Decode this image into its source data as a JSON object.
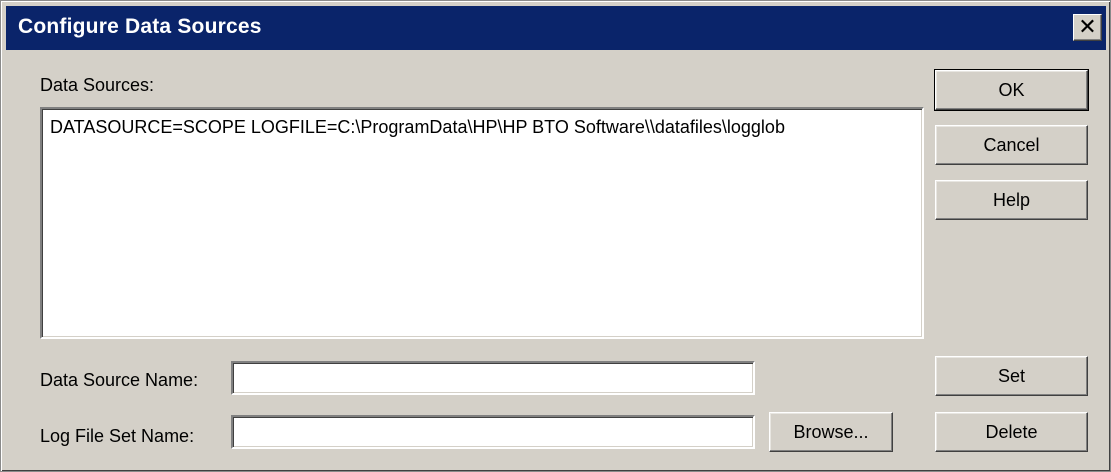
{
  "window": {
    "title": "Configure Data Sources",
    "close_glyph": "✕"
  },
  "data_sources": {
    "label": "Data Sources:",
    "items": [
      "DATASOURCE=SCOPE  LOGFILE=C:\\ProgramData\\HP\\HP BTO Software\\\\datafiles\\logglob"
    ]
  },
  "fields": {
    "data_source_name": {
      "label": "Data Source Name:",
      "value": ""
    },
    "log_file_set_name": {
      "label": "Log File Set Name:",
      "value": ""
    }
  },
  "buttons": {
    "ok": "OK",
    "cancel": "Cancel",
    "help": "Help",
    "set": "Set",
    "delete": "Delete",
    "browse": "Browse..."
  }
}
